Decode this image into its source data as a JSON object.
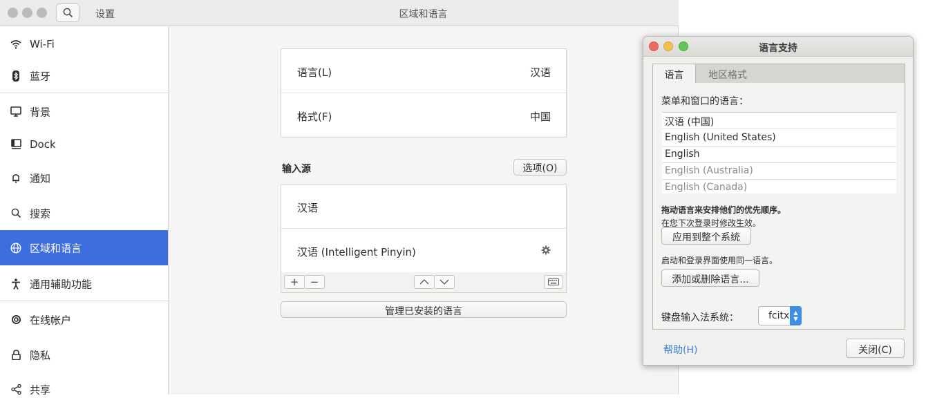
{
  "settings": {
    "app_title": "设置",
    "page_title": "区域和语言",
    "sidebar": {
      "items": [
        {
          "label": "Wi-Fi",
          "icon": "wifi-icon"
        },
        {
          "label": "蓝牙",
          "icon": "bluetooth-icon"
        },
        {
          "label": "背景",
          "icon": "monitor-icon"
        },
        {
          "label": "Dock",
          "icon": "dock-icon"
        },
        {
          "label": "通知",
          "icon": "bell-icon"
        },
        {
          "label": "搜索",
          "icon": "search-icon"
        },
        {
          "label": "区域和语言",
          "icon": "globe-icon",
          "active": true
        },
        {
          "label": "通用辅助功能",
          "icon": "accessibility-icon"
        },
        {
          "label": "在线帐户",
          "icon": "online-accounts-icon"
        },
        {
          "label": "隐私",
          "icon": "lock-icon"
        },
        {
          "label": "共享",
          "icon": "share-icon"
        }
      ]
    },
    "language_row": {
      "label": "语言(L)",
      "value": "汉语"
    },
    "formats_row": {
      "label": "格式(F)",
      "value": "中国"
    },
    "input_sources": {
      "title": "输入源",
      "options_button": "选项(O)",
      "items": [
        "汉语",
        "汉语 (Intelligent Pinyin)"
      ]
    },
    "manage_languages_button": "管理已安装的语言"
  },
  "dialog": {
    "title": "语言支持",
    "tabs": [
      "语言",
      "地区格式"
    ],
    "menu_language_label": "菜单和窗口的语言：",
    "languages": [
      "汉语 (中国)",
      "English (United States)",
      "English",
      "English (Australia)",
      "English (Canada)"
    ],
    "drag_hint": "拖动语言来安排他们的优先顺序。",
    "next_login_hint": "在您下次登录时修改生效。",
    "apply_system_button": "应用到整个系统",
    "apply_system_hint": "启动和登录界面使用同一语言。",
    "add_remove_button": "添加或删除语言...",
    "keyboard_input_label": "键盘输入法系统：",
    "keyboard_input_value": "fcitx",
    "help_link": "帮助(H)",
    "close_button": "关闭(C)"
  },
  "colors": {
    "accent": "#3d6ee0",
    "close_dot": "#ed6b5f",
    "minimize_dot": "#f5bf4f",
    "maximize_dot": "#62c655",
    "link": "#3d7fd6"
  }
}
